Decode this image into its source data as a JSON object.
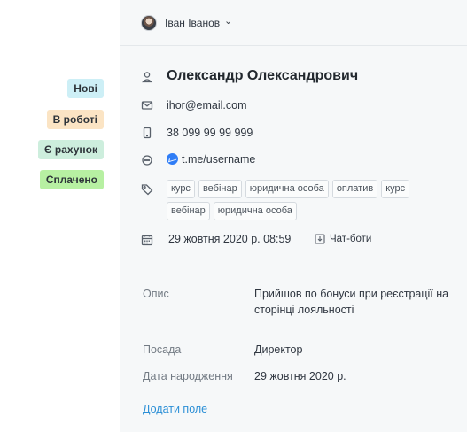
{
  "statuses": [
    {
      "label": "Нові",
      "color": "#cdeff6"
    },
    {
      "label": "В роботі",
      "color": "#fbe4c4"
    },
    {
      "label": "Є рахунок",
      "color": "#cdeedd"
    },
    {
      "label": "Сплачено",
      "color": "#b7f0a2"
    }
  ],
  "header": {
    "user_name": "Іван Іванов",
    "chevron": "⌄"
  },
  "contact": {
    "name": "Олександр Олександрович",
    "email": "ihor@email.com",
    "phone": "38 099 99 99 999",
    "messenger": "t.me/username",
    "tags": [
      "курс",
      "вебінар",
      "юридична особа",
      "оплатив",
      "курс",
      "вебінар",
      "юридична особа"
    ],
    "created": "29 жовтня 2020 р. 08:59",
    "source": "Чат-боти"
  },
  "fields": {
    "description_label": "Опис",
    "description_value": "Прийшов по бонуси при реєстрації на сторінці лояльності",
    "position_label": "Посада",
    "position_value": "Директор",
    "birthday_label": "Дата народження",
    "birthday_value": "29 жовтня 2020 р.",
    "add_field": "Додати поле"
  },
  "icons": {
    "name": "person-icon",
    "email": "envelope-icon",
    "phone": "phone-icon",
    "messenger": "chat-icon",
    "tags": "tag-icon",
    "date": "calendar-icon",
    "source": "download-icon"
  }
}
